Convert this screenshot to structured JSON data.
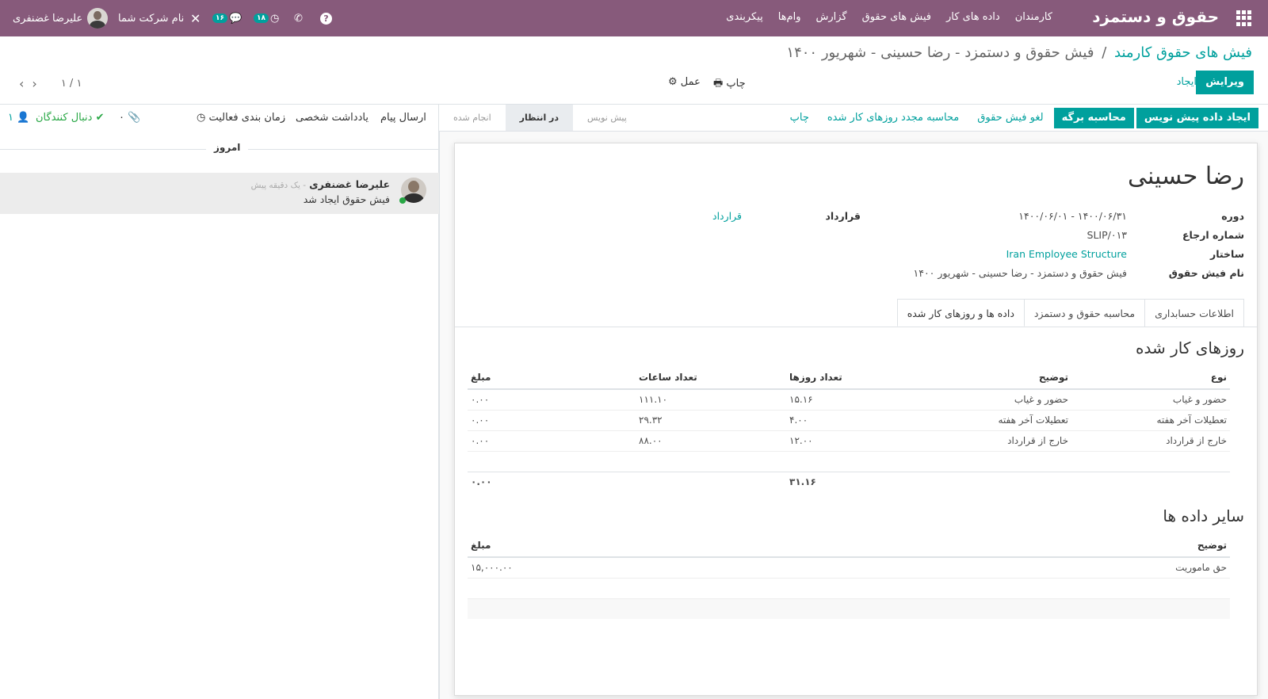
{
  "topbar": {
    "brand": "حقوق و دستمزد",
    "menu": [
      "کارمندان",
      "داده های کار",
      "فیش های حقوق",
      "گزارش",
      "وام‌ها",
      "پیکربندی"
    ],
    "user_name": "علیرضا غضنفری",
    "company": "نام شرکت شما",
    "activity_count": "۱۸",
    "message_count": "۱۶"
  },
  "breadcrumb": {
    "parent": "فیش های حقوق کارمند",
    "separator": "/",
    "current": "فیش حقوق و دستمزد - رضا حسینی - شهریور ۱۴۰۰"
  },
  "actions": {
    "edit": "ویرایش",
    "create": "ایجاد",
    "print": "چاپ",
    "action": "عمل",
    "pager": "۱ / ۱"
  },
  "statusbar": {
    "buttons_primary": [
      "ایجاد داده پیش نویس",
      "محاسبه برگه"
    ],
    "buttons_secondary": [
      "لغو فیش حقوق",
      "محاسبه مجدد روزهای کار شده",
      "چاپ"
    ],
    "stages": [
      "پیش نویس",
      "در انتظار",
      "انجام شده"
    ],
    "active_stage": "در انتظار"
  },
  "form": {
    "employee": "رضا حسینی",
    "fields": {
      "period_label": "دوره",
      "period_value": "۱۴۰۰/۰۶/۰۱ - ۱۴۰۰/۰۶/۳۱",
      "ref_label": "شماره ارجاع",
      "ref_value": "SLIP/۰۱۳",
      "struct_label": "ساختار",
      "struct_value": "Iran Employee Structure",
      "name_label": "نام فیش حقوق",
      "name_value": "فیش حقوق و دستمزد - رضا حسینی - شهریور ۱۴۰۰",
      "contract_label": "قرارداد",
      "contract_value": "قرارداد"
    },
    "tabs": [
      "داده ها و روزهای کار شده",
      "محاسبه حقوق و دستمزد",
      "اطلاعات حسابداری"
    ],
    "worked_days": {
      "title": "روزهای کار شده",
      "headers": [
        "نوع",
        "توضیح",
        "تعداد روزها",
        "تعداد ساعات",
        "مبلغ"
      ],
      "rows": [
        [
          "حضور و غیاب",
          "حضور و غیاب",
          "۱۵.۱۶",
          "۱۱۱.۱۰",
          "۰.۰۰"
        ],
        [
          "تعطیلات آخر هفته",
          "تعطیلات آخر هفته",
          "۴.۰۰",
          "۲۹.۳۲",
          "۰.۰۰"
        ],
        [
          "خارج از قرارداد",
          "خارج از قرارداد",
          "۱۲.۰۰",
          "۸۸.۰۰",
          "۰.۰۰"
        ]
      ],
      "total_days": "۳۱.۱۶",
      "total_amount": "۰.۰۰"
    },
    "other_inputs": {
      "title": "سایر داده ها",
      "headers": [
        "توضیح",
        "مبلغ"
      ],
      "rows": [
        [
          "حق ماموریت",
          "۱۵,۰۰۰.۰۰"
        ]
      ]
    }
  },
  "chatter": {
    "send_message": "ارسال پیام",
    "log_note": "یادداشت شخصی",
    "schedule_activity": "زمان بندی فعالیت",
    "attachments": "۰",
    "follow": "دنبال کنندگان",
    "followers": "۱",
    "today": "امروز",
    "message_author": "علیرضا غضنفری",
    "message_time": "- یک دقیقه پیش",
    "message_body": "فیش حقوق ایجاد شد"
  }
}
